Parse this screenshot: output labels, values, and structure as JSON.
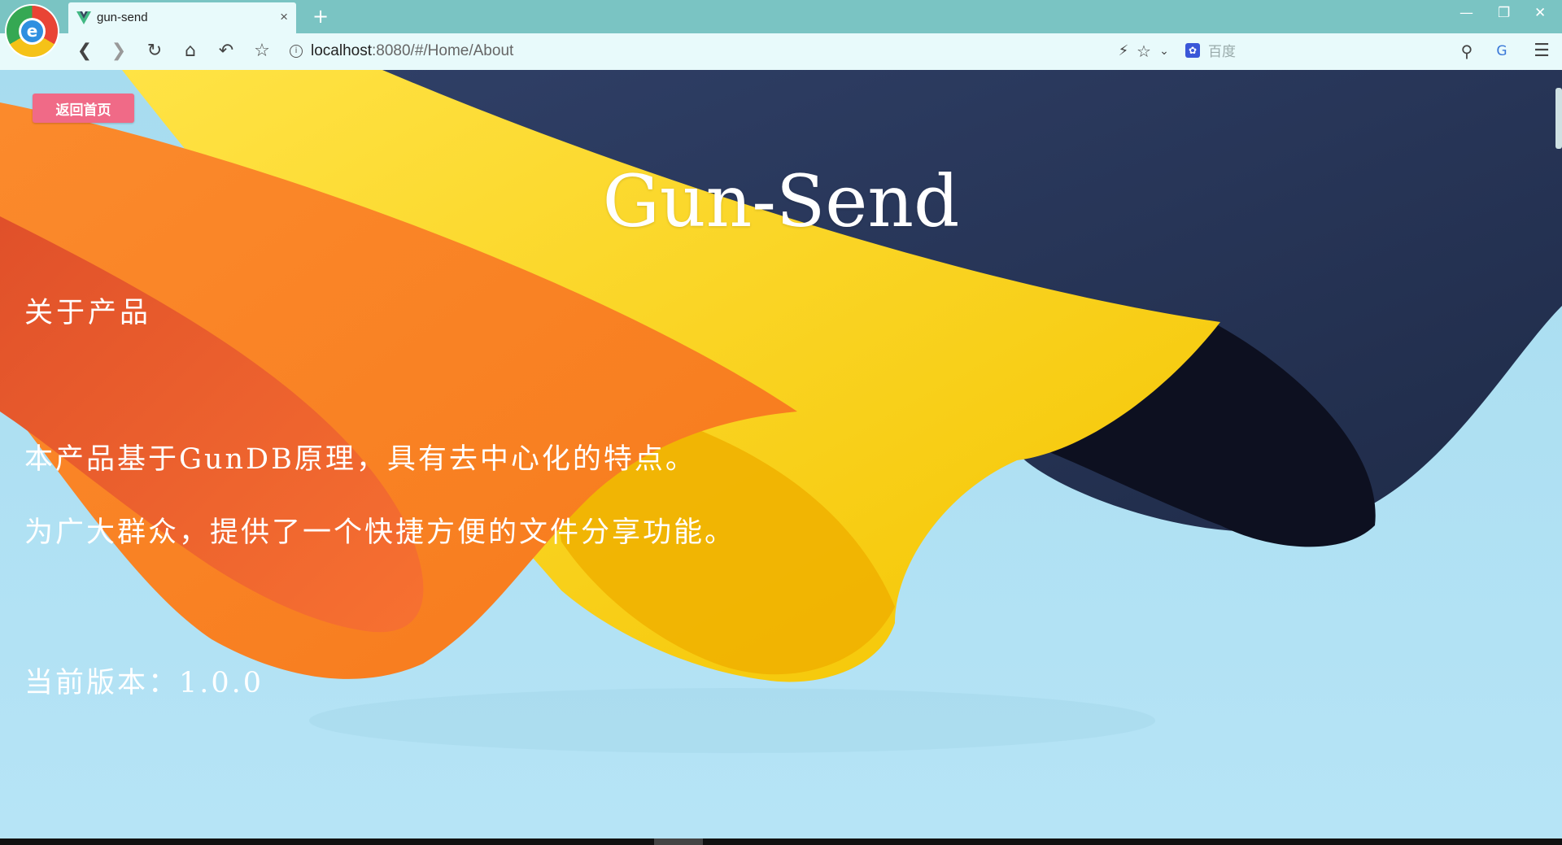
{
  "browser": {
    "tab_title": "gun-send",
    "url_host": "localhost",
    "url_rest": ":8080/#/Home/About",
    "search_engine": "百度",
    "new_tab_symbol": "+",
    "close_symbol": "×"
  },
  "page": {
    "back_button": "返回首页",
    "title": "Gun-Send",
    "heading": "关于产品",
    "paragraph_1": "本产品基于GunDB原理，具有去中心化的特点。",
    "paragraph_2": "为广大群众，提供了一个快捷方便的文件分享功能。",
    "version": "当前版本：1.0.0"
  },
  "colors": {
    "tabbar": "#7ac4c3",
    "toolbar": "#e8fafb",
    "back_button": "#f06a87"
  }
}
